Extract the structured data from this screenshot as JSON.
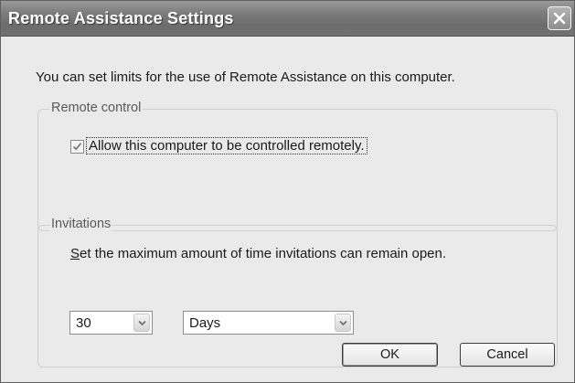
{
  "window": {
    "title": "Remote Assistance Settings"
  },
  "intro_text": "You can set limits for the use of Remote Assistance on this computer.",
  "remote_control": {
    "group_label": "Remote control",
    "checkbox_label": "Allow this computer to be controlled remotely.",
    "checked": true
  },
  "invitations": {
    "group_label": "Invitations",
    "description_accel": "S",
    "description_rest": "et the maximum amount of time invitations can remain open.",
    "amount_value": "30",
    "unit_value": "Days"
  },
  "buttons": {
    "ok_label": "OK",
    "cancel_label": "Cancel"
  },
  "icons": {
    "close": "close-icon",
    "checkmark": "checkmark-icon",
    "dropdown": "chevron-down-icon"
  }
}
